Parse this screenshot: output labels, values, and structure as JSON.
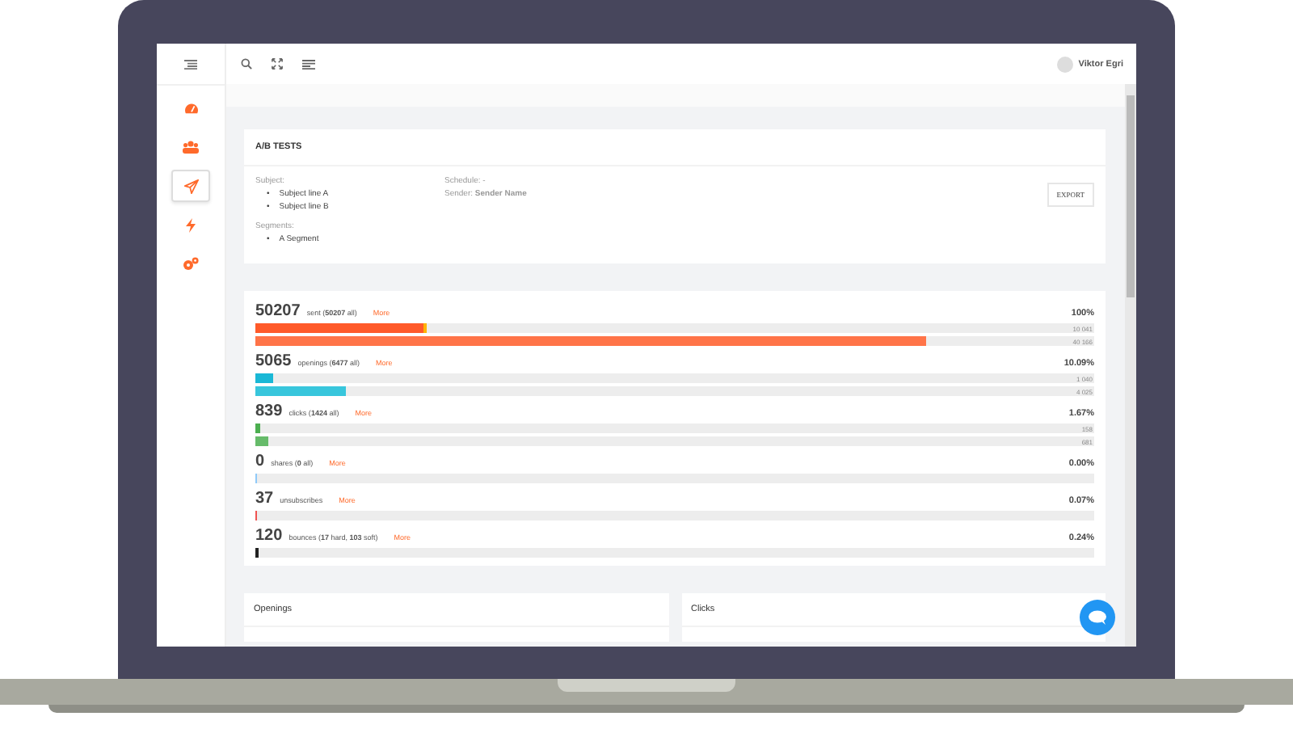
{
  "topbar": {
    "user": "Viktor Egri"
  },
  "sidebar": {
    "items": [
      {
        "kind": "gauge",
        "selected": false
      },
      {
        "kind": "users",
        "selected": false
      },
      {
        "kind": "plane",
        "selected": true
      },
      {
        "kind": "bolt",
        "selected": false
      },
      {
        "kind": "gears",
        "selected": false
      }
    ]
  },
  "ab_tests": {
    "title": "A/B TESTS",
    "subject_label": "Subject:",
    "subjects": [
      {
        "bullet": "•",
        "text": "Subject line A"
      },
      {
        "bullet": "•",
        "text": "Subject line B"
      }
    ],
    "segments_label": "Segments:",
    "segments": [
      {
        "bullet": "•",
        "text": "A Segment"
      }
    ],
    "schedule": "Schedule: -",
    "sender": "Sender: **Sender Name**",
    "export": "EXPORT"
  },
  "stats": [
    {
      "count": "50207",
      "text": "sent (**50207** all)",
      "more": "More",
      "percent": "100%",
      "bars": [
        {
          "kind": "marked",
          "color": "#ff5a2a",
          "level": 0.2,
          "reading": "10 041"
        },
        {
          "kind": "plain",
          "color": "#ff7448",
          "level": 0.8,
          "reading": "40 166"
        }
      ]
    },
    {
      "count": "5065",
      "text": "openings (**6477** all)",
      "more": "More",
      "percent": "10.09%",
      "bars": [
        {
          "kind": "plain",
          "color": "#1ab8d6",
          "level": 0.022,
          "reading": "1 040"
        },
        {
          "kind": "plain",
          "color": "#38c6dc",
          "level": 0.108,
          "reading": "4 025"
        }
      ]
    },
    {
      "count": "839",
      "text": "clicks (**1424** all)",
      "more": "More",
      "percent": "1.67%",
      "bars": [
        {
          "kind": "plain",
          "color": "#4caf50",
          "level": 0.005,
          "reading": "158"
        },
        {
          "kind": "plain",
          "color": "#66bb6a",
          "level": 0.015,
          "reading": "681"
        }
      ]
    },
    {
      "count": "0",
      "text": "shares (**0** all)",
      "more": "More",
      "percent": "0.00%",
      "bars": [
        {
          "kind": "plain",
          "color": "#90caf9",
          "level": 0.002
        }
      ]
    },
    {
      "count": "37",
      "text": "unsubscribes",
      "more": "More",
      "percent": "0.07%",
      "bars": [
        {
          "kind": "plain",
          "color": "#ef5350",
          "level": 0.002
        }
      ]
    },
    {
      "count": "120",
      "text": "bounces (**17** hard, **103** soft)",
      "more": "More",
      "percent": "0.24%",
      "bars": [
        {
          "kind": "plain",
          "color": "#222222",
          "level": 0.003
        }
      ]
    }
  ],
  "panels": [
    "Openings",
    "Clicks"
  ]
}
